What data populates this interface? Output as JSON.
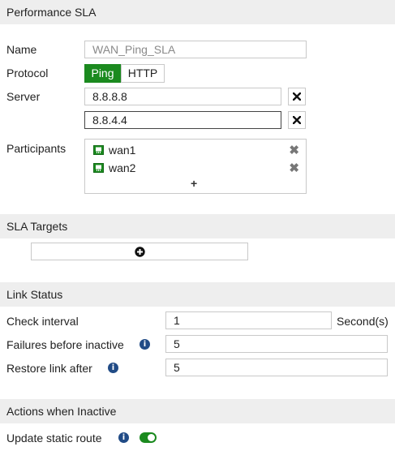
{
  "performance_sla": {
    "header": "Performance SLA",
    "name_label": "Name",
    "name_placeholder": "WAN_Ping_SLA",
    "protocol_label": "Protocol",
    "protocol_options": [
      "Ping",
      "HTTP"
    ],
    "protocol_selected": "Ping",
    "server_label": "Server",
    "servers": [
      "8.8.8.8",
      "8.8.4.4"
    ],
    "participants_label": "Participants",
    "participants": [
      "wan1",
      "wan2"
    ]
  },
  "sla_targets": {
    "header": "SLA Targets"
  },
  "link_status": {
    "header": "Link Status",
    "check_interval_label": "Check interval",
    "check_interval_value": "1",
    "check_interval_unit": "Second(s)",
    "failures_label": "Failures before inactive",
    "failures_value": "5",
    "restore_label": "Restore link after",
    "restore_value": "5"
  },
  "actions": {
    "header": "Actions when Inactive",
    "update_static_route_label": "Update static route",
    "update_static_route_enabled": true
  },
  "colors": {
    "accent_green": "#1b8a1f",
    "info_blue": "#214b86",
    "section_bg": "#eeeeee"
  },
  "icons": {
    "remove": "close-icon",
    "interface": "interface-port-icon",
    "info": "info-icon",
    "add": "plus-circle-icon"
  }
}
